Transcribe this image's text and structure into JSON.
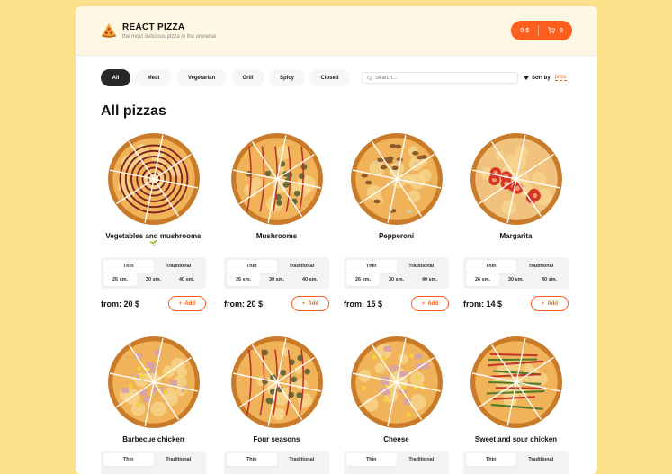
{
  "header": {
    "title": "REACT PIZZA",
    "subtitle": "the most delicious pizza in the universe",
    "cart_total": "0 $",
    "cart_count": "0"
  },
  "categories": [
    "All",
    "Meat",
    "Vegetarian",
    "Grill",
    "Spicy",
    "Closed"
  ],
  "active_category": "All",
  "search": {
    "placeholder": "Search..."
  },
  "sort": {
    "label": "Sort by:",
    "value": "price"
  },
  "section_title": "All pizzas",
  "pizzas": [
    {
      "name": "Vegetables and mushrooms",
      "badge": "🌱",
      "price": "from: 20 $",
      "style": "bbq"
    },
    {
      "name": "Mushrooms",
      "price": "from: 20 $",
      "style": "mushroom"
    },
    {
      "name": "Pepperoni",
      "price": "from: 15 $",
      "style": "pepperoni"
    },
    {
      "name": "Margarita",
      "price": "from: 14 $",
      "style": "margarita"
    },
    {
      "name": "Barbecue chicken",
      "price": "",
      "style": "chicken"
    },
    {
      "name": "Four seasons",
      "price": "",
      "style": "mushroom"
    },
    {
      "name": "Cheese",
      "price": "",
      "style": "chicken"
    },
    {
      "name": "Sweet and sour chicken",
      "price": "",
      "style": "sweet"
    }
  ],
  "dough_types": [
    "Thin",
    "Traditional"
  ],
  "sizes": [
    "26 sm.",
    "30 sm.",
    "40 sm."
  ],
  "add_label": "Add",
  "colors": {
    "accent": "#fe5f1e",
    "background": "#fde18a",
    "dark": "#282828"
  }
}
